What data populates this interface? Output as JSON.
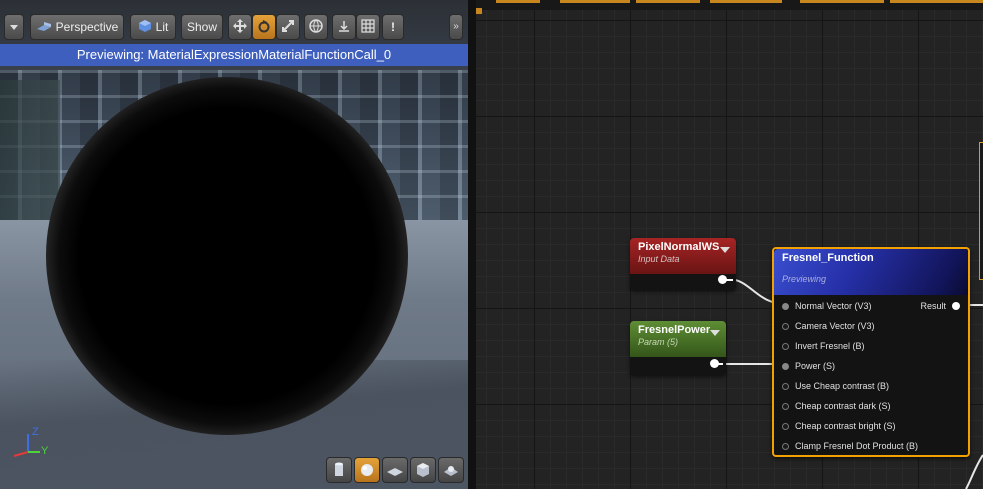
{
  "viewport": {
    "toolbar": {
      "menu_icon": "dropdown-arrow-icon",
      "perspective_label": "Perspective",
      "perspective_icon": "perspective-cube-icon",
      "lit_label": "Lit",
      "lit_icon": "lit-sphere-icon",
      "show_label": "Show",
      "transform_icons": [
        "translate-icon",
        "rotate-icon",
        "scale-icon",
        "world-local-icon",
        "surface-snap-icon",
        "grid-snap-icon"
      ],
      "more_label": "!",
      "collapse_icon": "chevron-right-icon"
    },
    "preview_label": "Previewing: MaterialExpressionMaterialFunctionCall_0",
    "axis": {
      "x": "X",
      "y": "Y",
      "z": "Z"
    },
    "preview_shapes": [
      "cylinder-icon",
      "sphere-icon",
      "plane-icon",
      "cube-icon",
      "custom-mesh-icon"
    ],
    "active_shape": "sphere-icon",
    "colors": {
      "preview_bar": "#3e5fbd",
      "active_button": "#e4a23a"
    }
  },
  "graph": {
    "nodes": {
      "pixel_normal": {
        "title": "PixelNormalWS",
        "subtitle": "Input Data",
        "color": "#8c1c1c"
      },
      "fresnel_power": {
        "title": "FresnelPower",
        "subtitle": "Param (5)",
        "color": "#4e7a2a"
      },
      "fresnel_function": {
        "title": "Fresnel_Function",
        "subtitle": "Previewing",
        "output": "Result",
        "inputs": [
          "Normal Vector (V3)",
          "Camera Vector (V3)",
          "Invert Fresnel (B)",
          "Power (S)",
          "Use Cheap contrast (B)",
          "Cheap contrast dark (S)",
          "Cheap contrast bright (S)",
          "Clamp Fresnel Dot Product (B)"
        ],
        "connected_inputs": [
          0,
          3
        ],
        "border_color": "#f2a200"
      }
    }
  }
}
